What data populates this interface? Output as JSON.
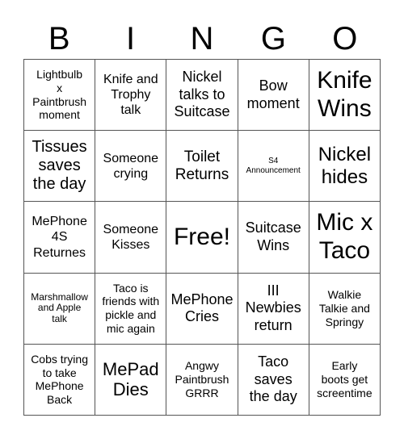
{
  "header": {
    "letters": [
      "B",
      "I",
      "N",
      "G",
      "O"
    ]
  },
  "cells": [
    [
      "Lightbulb\nx\nPaintbrush\nmoment",
      "Knife and\nTrophy\ntalk",
      "Nickel\ntalks to\nSuitcase",
      "Bow\nmoment",
      "Knife\nWins"
    ],
    [
      "Tissues\nsaves\nthe day",
      "Someone\ncrying",
      "Toilet\nReturns",
      "S4\nAnnouncement",
      "Nickel\nhides"
    ],
    [
      "MePhone\n4S\nReturnes",
      "Someone\nKisses",
      "Free!",
      "Suitcase\nWins",
      "Mic x\nTaco"
    ],
    [
      "Marshmallow\nand Apple\ntalk",
      "Taco is\nfriends with\npickle and\nmic again",
      "MePhone\nCries",
      "III\nNewbies\nreturn",
      "Walkie\nTalkie and\nSpringy"
    ],
    [
      "Cobs trying\nto take\nMePhone\nBack",
      "MePad\nDies",
      "Angwy\nPaintbrush\nGRRR",
      "Taco\nsaves\nthe day",
      "Early\nboots get\nscreentime"
    ]
  ]
}
